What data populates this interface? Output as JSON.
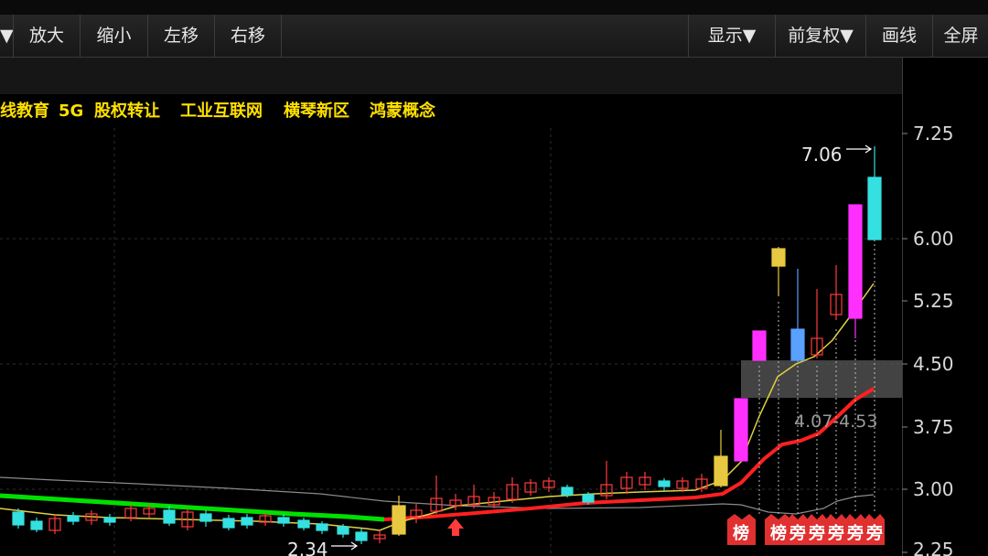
{
  "toolbar": {
    "left_arrow": "▼",
    "zoom_in": "放大",
    "zoom_out": "缩小",
    "move_left": "左移",
    "move_right": "右移",
    "display": "显示▼",
    "adjust": "前复权▼",
    "draw": "画线",
    "fullscreen": "全屏"
  },
  "concept_tags": [
    "线教育",
    "5G",
    "股权转让",
    "工业互联网",
    "横琴新区",
    "鸿蒙概念"
  ],
  "price_axis": {
    "ticks": [
      "7.25",
      "6.00",
      "5.25",
      "4.50",
      "3.75",
      "3.00",
      "2.25"
    ]
  },
  "annotations": {
    "high_label": "7.06",
    "low_label": "2.34",
    "zone_label": "4.07-4.53"
  },
  "badges": [
    "榜",
    "榜",
    "旁",
    "旁",
    "旁",
    "旁",
    "旁"
  ],
  "colors": {
    "up": "#ff3b3b",
    "down": "#35e0e0",
    "limit_up": "#ff30ff",
    "yellow": "#e8c840",
    "blue": "#5aa0ff",
    "ma_green": "#00e000",
    "ma_red": "#ff2020",
    "ma_yellow": "#e0d040",
    "tag": "#ffe000"
  }
}
